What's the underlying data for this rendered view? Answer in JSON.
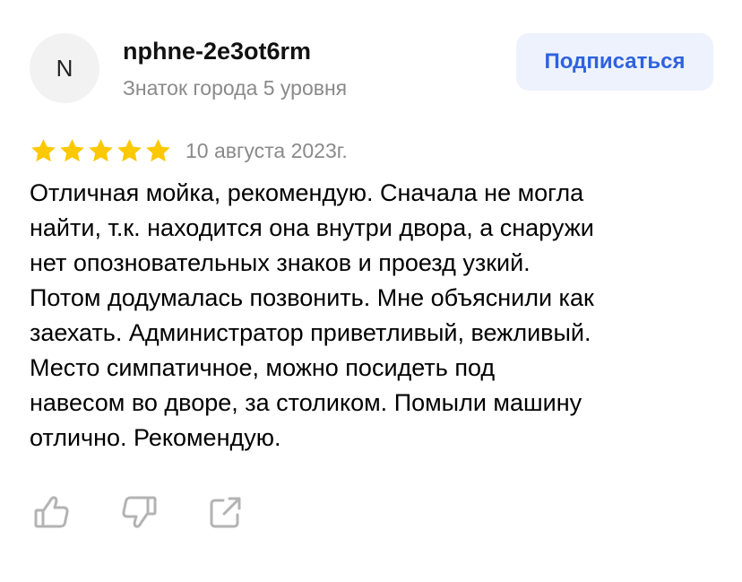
{
  "author": {
    "avatar_initial": "N",
    "name": "nphne-2e3ot6rm",
    "level": "Знаток города 5 уровня"
  },
  "subscribe": {
    "label": "Подписаться"
  },
  "review": {
    "rating": 5,
    "rating_max": 5,
    "date": "10 августа 2023г.",
    "text": "Отличная мойка, рекомендую. Сначала не могла\nнайти, т.к. находится она внутри двора, а снаружи\nнет опозновательных знаков и проезд узкий.\nПотом додумалась позвонить. Мне объяснили как\nзаехать. Администратор приветливый, вежливый.\nМесто симпатичное,  можно посидеть под\nнавесом во дворе, за столиком. Помыли машину\nотлично. Рекомендую."
  },
  "actions": {
    "like_icon": "thumbs-up-icon",
    "dislike_icon": "thumbs-down-icon",
    "share_icon": "share-icon"
  },
  "colors": {
    "star": "#fcc800",
    "accent": "#2f62df",
    "button_bg": "#edf2fc",
    "muted_text": "#8a8a8a",
    "icon": "#b3b3b3"
  }
}
